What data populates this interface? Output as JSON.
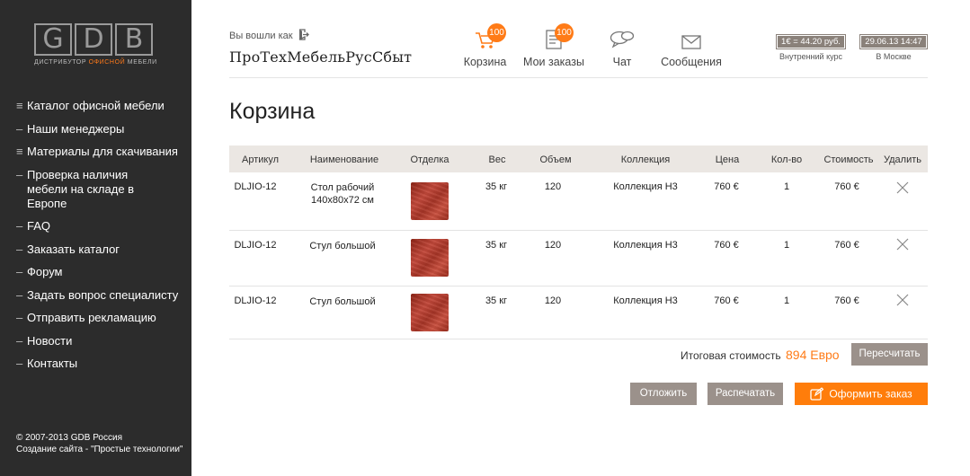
{
  "logo": {
    "letters": [
      "G",
      "D",
      "B"
    ],
    "tagline_pre": "ДИСТРИБУТОР ",
    "tagline_accent": "ОФИСНОЙ",
    "tagline_post": " МЕБЕЛИ"
  },
  "sidebar": {
    "items": [
      {
        "marker": "≡",
        "label": "Каталог офисной мебели"
      },
      {
        "marker": "–",
        "label": "Наши менеджеры"
      },
      {
        "marker": "≡",
        "label": "Материалы для скачивания"
      },
      {
        "marker": "–",
        "label": "Проверка наличия мебели на складе в Европе"
      },
      {
        "marker": "–",
        "label": "FAQ"
      },
      {
        "marker": "–",
        "label": "Заказать каталог"
      },
      {
        "marker": "–",
        "label": "Форум"
      },
      {
        "marker": "–",
        "label": "Задать вопрос специалисту"
      },
      {
        "marker": "–",
        "label": "Отправить рекламацию"
      },
      {
        "marker": "–",
        "label": "Новости"
      },
      {
        "marker": "–",
        "label": "Контакты"
      }
    ],
    "footer_line1": "© 2007-2013 GDB Россия",
    "footer_line2": "Создание сайта - \"Простые технологии\""
  },
  "header": {
    "logged_in_label": "Вы вошли как",
    "company": "ПроТехМебельРусСбыт",
    "nav": [
      {
        "label": "Корзина",
        "badge": "100",
        "icon": "cart-icon"
      },
      {
        "label": "Мои заказы",
        "badge": "100",
        "icon": "orders-icon"
      },
      {
        "label": "Чат",
        "icon": "chat-icon"
      },
      {
        "label": "Сообщения",
        "icon": "envelope-icon"
      }
    ],
    "rate_value": "1€ = 44.20 руб.",
    "rate_caption": "Внутренний курс",
    "datetime_value": "29.06.13 14:47",
    "datetime_caption": "В Москве"
  },
  "page_title": "Корзина",
  "table": {
    "headers": [
      "Артикул",
      "Наименование",
      "Отделка",
      "Вес",
      "Объем",
      "Коллекция",
      "Цена",
      "Кол-во",
      "Стоимость",
      "Удалить"
    ],
    "rows": [
      {
        "article": "DLJIO-12",
        "name": "Стол рабочий 140x80x72 см",
        "weight": "35 кг",
        "volume": "120",
        "collection": "Коллекция Н3",
        "price": "760 €",
        "qty": "1",
        "cost": "760 €"
      },
      {
        "article": "DLJIO-12",
        "name": "Стул большой",
        "weight": "35 кг",
        "volume": "120",
        "collection": "Коллекция Н3",
        "price": "760 €",
        "qty": "1",
        "cost": "760 €"
      },
      {
        "article": "DLJIO-12",
        "name": "Стул большой",
        "weight": "35 кг",
        "volume": "120",
        "collection": "Коллекция Н3",
        "price": "760 €",
        "qty": "1",
        "cost": "760 €"
      }
    ]
  },
  "totals": {
    "label": "Итоговая стоимость",
    "value": "894 Евро"
  },
  "buttons": {
    "recalc": "Пересчитать",
    "postpone": "Отложить",
    "print": "Распечатать",
    "checkout": "Оформить заказ"
  },
  "colors": {
    "accent": "#ff7b17",
    "sidebar": "#2c2c2c",
    "button_gray": "#9b918b"
  }
}
